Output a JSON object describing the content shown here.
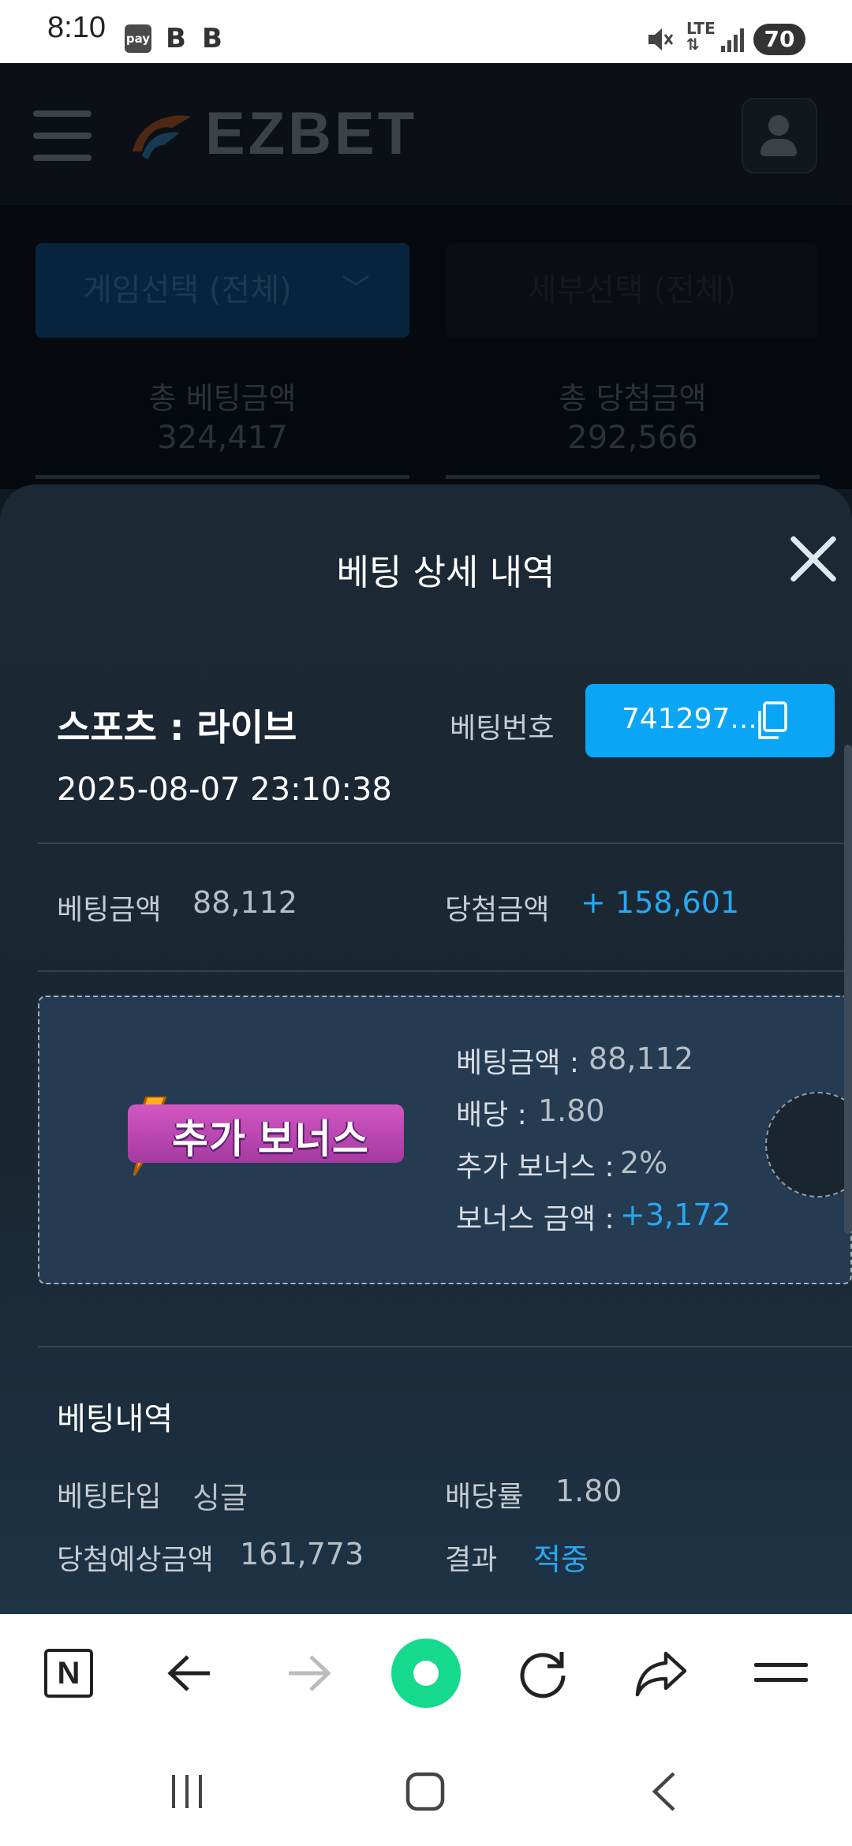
{
  "status_bar": {
    "time": "8:10",
    "pay_label": "pay",
    "b_icon_1": "B",
    "b_icon_2": "B",
    "network": "LTE",
    "battery": "70",
    "icons": [
      "pay-icon",
      "b-app-icon",
      "b-app-icon",
      "mute-icon",
      "lte-icon",
      "signal-icon",
      "battery-icon"
    ]
  },
  "header": {
    "logo_text": "EZBET"
  },
  "filters": {
    "game_select": "게임선택 (전체)",
    "detail_select": "세부선택 (전체)"
  },
  "totals": {
    "bet_label": "총 베팅금액",
    "bet_value": "324,417",
    "win_label": "총 당첨금액",
    "win_value": "292,566"
  },
  "sheet": {
    "title": "베팅 상세 내역",
    "category": "스포츠 : 라이브",
    "bet_number_label": "베팅번호",
    "bet_number_value": "741297...",
    "datetime": "2025-08-07 23:10:38",
    "bet_amount_label": "베팅금액",
    "bet_amount_value": "88,112",
    "win_amount_label": "당첨금액",
    "win_amount_value": "+ 158,601",
    "bonus": {
      "badge_text": "추가 보너스",
      "rows": [
        {
          "label": "베팅금액 :",
          "value": "88,112"
        },
        {
          "label": "배당 :",
          "value": "1.80"
        },
        {
          "label": "추가 보너스 :",
          "value": "2%"
        },
        {
          "label": "보너스 금액 :",
          "value": "+3,172"
        }
      ]
    },
    "history": {
      "title": "베팅내역",
      "type_label": "베팅타입",
      "type_value": "싱글",
      "odds_label": "배당률",
      "odds_value": "1.80",
      "expected_label": "당첨예상금액",
      "expected_value": "161,773",
      "result_label": "결과",
      "result_value": "적중"
    }
  },
  "toolbar": {
    "n_label": "N",
    "icons": [
      "naver-home-icon",
      "back-arrow-icon",
      "forward-arrow-icon",
      "green-dot-icon",
      "refresh-icon",
      "share-icon",
      "menu-icon"
    ]
  },
  "nav": {
    "icons": [
      "recent-apps-icon",
      "home-icon",
      "back-icon"
    ]
  },
  "colors": {
    "accent": "#0aa6f5",
    "positive": "#27a8f2",
    "bonus_badge": "#c94fbd",
    "sheet_bg": "#1c2834"
  }
}
